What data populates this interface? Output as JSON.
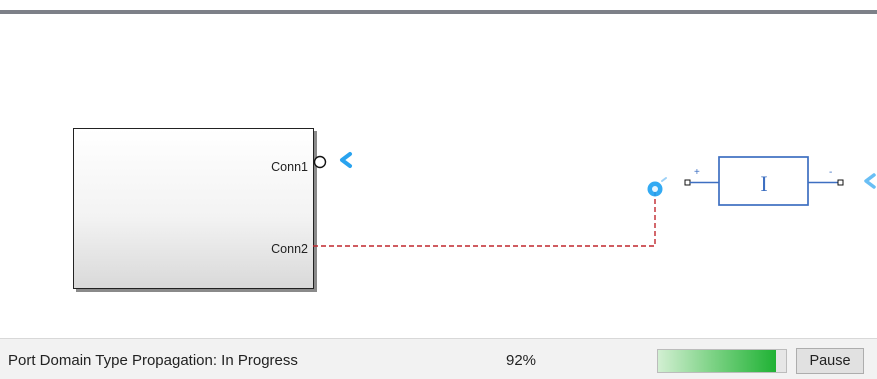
{
  "model": {
    "subsystem": {
      "ports": [
        {
          "label": "Conn1"
        },
        {
          "label": "Conn2"
        }
      ]
    },
    "component": {
      "plus_label": "+",
      "minus_label": "-",
      "symbol": "I"
    },
    "colors": {
      "wire": "#c0272d",
      "block_outline": "#3d6fc1",
      "port_highlight": "#1da1f2"
    }
  },
  "status_bar": {
    "message": "Port Domain Type Propagation: In Progress",
    "percent_label": "92%",
    "progress_fraction": 0.92,
    "pause_label": "Pause"
  }
}
